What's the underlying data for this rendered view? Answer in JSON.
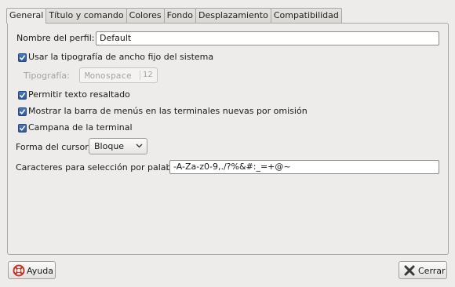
{
  "tabs": [
    {
      "label": "General",
      "active": true
    },
    {
      "label": "Título y comando"
    },
    {
      "label": "Colores"
    },
    {
      "label": "Fondo"
    },
    {
      "label": "Desplazamiento"
    },
    {
      "label": "Compatibilidad"
    }
  ],
  "general": {
    "profile_name_label": "Nombre del perfil:",
    "profile_name_value": "Default",
    "use_system_font_label": "Usar la tipografía de ancho fijo del sistema",
    "font_label": "Tipografía:",
    "font_name": "Monospace",
    "font_size": "12",
    "allow_bold_label": "Permitir texto resaltado",
    "show_menubar_label": "Mostrar la barra de menús en las terminales nuevas por omisión",
    "bell_label": "Campana de la terminal",
    "cursor_shape_label": "Forma del cursor:",
    "cursor_shape_value": "Bloque",
    "word_chars_label": "Caracteres para selección por palabra:",
    "word_chars_value": "-A-Za-z0-9,./?%&#:_=+@~"
  },
  "checkboxes": {
    "use_system_font": true,
    "allow_bold": true,
    "show_menubar": true,
    "bell": true
  },
  "buttons": {
    "help": "Ayuda",
    "close": "Cerrar"
  },
  "colors": {
    "check_blue": "#2f5a9c",
    "window_bg": "#edeceb"
  }
}
